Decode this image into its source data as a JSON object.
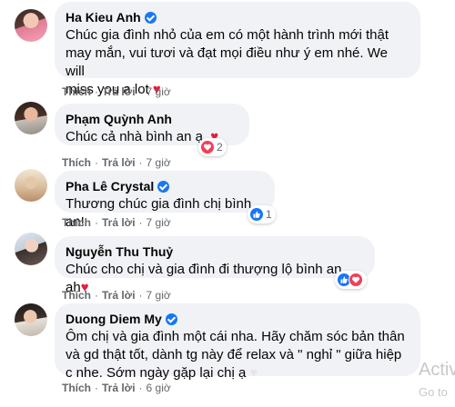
{
  "actions": {
    "like": "Thích",
    "reply": "Trả lời",
    "sep": "·"
  },
  "comments": [
    {
      "name": "Ha Kieu Anh",
      "verified": true,
      "lines": [
        "Chúc gia đình nhỏ của em có một hành trình mới thật",
        "may mắn, vui tươi và đạt mọi điều như ý em nhé. We will",
        "miss you a lot"
      ],
      "trailing_icon": "red-heart-emoji",
      "time": "7 giờ"
    },
    {
      "name": "Phạm Quỳnh Anh",
      "verified": false,
      "lines": [
        "Chúc cả nhà bình an ạ."
      ],
      "trailing_icon": "red-heart-emoji",
      "time": "7 giờ",
      "reactions": {
        "icons": [
          "love-reaction-icon"
        ],
        "count": "2"
      }
    },
    {
      "name": "Pha Lê Crystal",
      "verified": true,
      "lines": [
        "Thương chúc gia đình chị bình an!"
      ],
      "time": "7 giờ",
      "reactions": {
        "icons": [
          "like-reaction-icon"
        ],
        "count": "1"
      }
    },
    {
      "name": "Nguyễn Thu Thuỷ",
      "verified": false,
      "lines": [
        "Chúc cho chị và gia đình đi thượng lộ bình an ah"
      ],
      "trailing_icon": "red-heart-emoji",
      "time": "7 giờ",
      "reactions": {
        "icons": [
          "like-reaction-icon",
          "love-reaction-icon"
        ],
        "count": ""
      }
    },
    {
      "name": "Duong Diem My",
      "verified": true,
      "lines": [
        "Ôm chị và gia đình một cái nha. Hãy chăm sóc bản thân",
        "và gd thật tốt, dành tg này để relax và \" nghỉ \" giữa hiệp",
        "c nhe. Sớm ngày gặp lại chị ạ"
      ],
      "trailing_icon": "white-heart-emoji",
      "time": "6 giờ"
    }
  ],
  "watermark": {
    "line1": "Activ",
    "line2": "Go to"
  },
  "colors": {
    "bubble": "#f0f2f5",
    "meta": "#65676b",
    "verified": "#1877f2",
    "heart": "#e41e3f"
  }
}
